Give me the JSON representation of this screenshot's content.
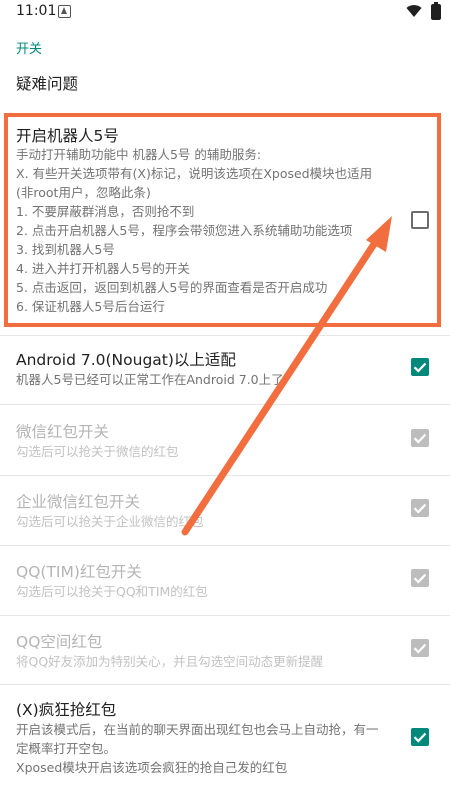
{
  "status_bar": {
    "time": "11:01",
    "icons": [
      "notification-icon",
      "wifi-icon",
      "battery-icon"
    ]
  },
  "category": {
    "title": "开关"
  },
  "troubleshoot": {
    "label": "疑难问题"
  },
  "accessibility_pref": {
    "title": "开启机器人5号",
    "summary": "手动打开辅助功能中 机器人5号 的辅助服务:\n X. 有些开关选项带有(X)标记，说明该选项在Xposed模块也适用(非root用户，忽略此条)\n 1. 不要屏蔽群消息，否则抢不到\n 2. 点击开启机器人5号，程序会带领您进入系统辅助功能选项\n 3. 找到机器人5号\n 4. 进入并打开机器人5号的开关\n 5. 点击返回，返回到机器人5号的界面查看是否开启成功\n 6. 保证机器人5号后台运行",
    "checked": false
  },
  "nougat_pref": {
    "title": "Android 7.0(Nougat)以上适配",
    "summary": "机器人5号已经可以正常工作在Android 7.0上了",
    "checked": true
  },
  "wechat_pref": {
    "title": "微信红包开关",
    "summary": "勾选后可以抢关于微信的红包",
    "checked": true,
    "enabled": false
  },
  "wework_pref": {
    "title": "企业微信红包开关",
    "summary": "勾选后可以抢关于企业微信的红包",
    "checked": true,
    "enabled": false
  },
  "qq_pref": {
    "title": "QQ(TIM)红包开关",
    "summary": "勾选后可以抢关于QQ和TIM的红包",
    "checked": true,
    "enabled": false
  },
  "qzone_pref": {
    "title": "QQ空间红包",
    "summary": "将QQ好友添加为特别关心，并且勾选空间动态更新提醒",
    "checked": true,
    "enabled": false
  },
  "crazy_pref": {
    "title": "(X)疯狂抢红包",
    "summary": "开启该模式后，在当前的聊天界面出现红包也会马上自动抢，有一定概率打开空包。\nXposed模块开启该选项会疯狂的抢自己发的红包",
    "checked": true
  },
  "colors": {
    "accent": "#00897b",
    "annotation": "#f36e3f",
    "disabled_checkbox": "#bdbdbd"
  }
}
